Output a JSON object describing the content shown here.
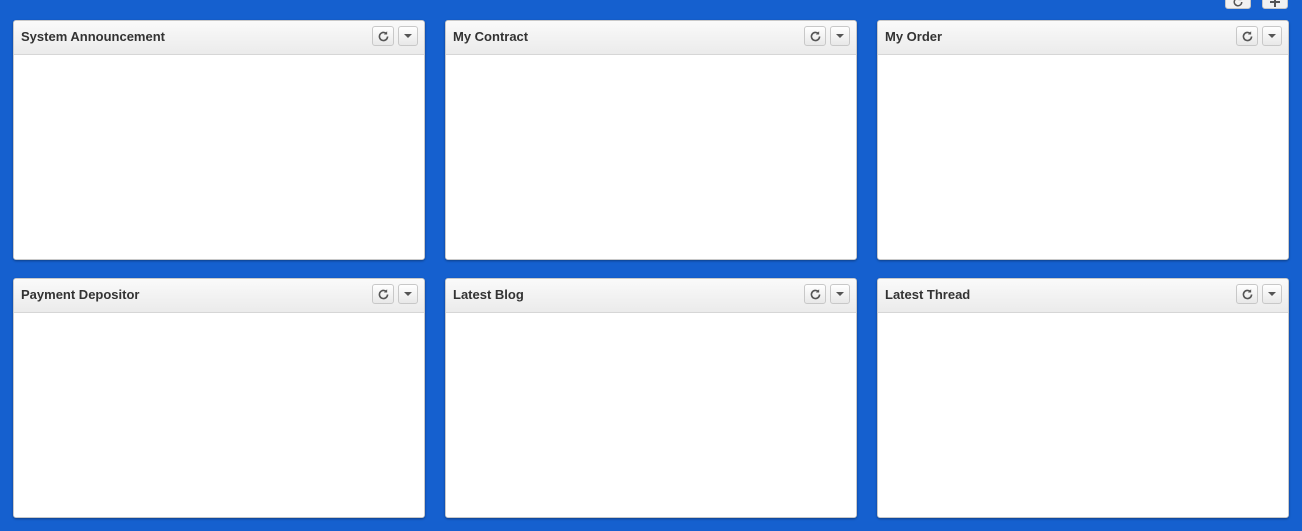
{
  "toolbar": {
    "refresh_icon": "refresh-icon",
    "add_icon": "plus-icon"
  },
  "widgets": [
    {
      "title": "System Announcement"
    },
    {
      "title": "My Contract"
    },
    {
      "title": "My Order"
    },
    {
      "title": "Payment Depositor"
    },
    {
      "title": "Latest Blog"
    },
    {
      "title": "Latest Thread"
    }
  ]
}
